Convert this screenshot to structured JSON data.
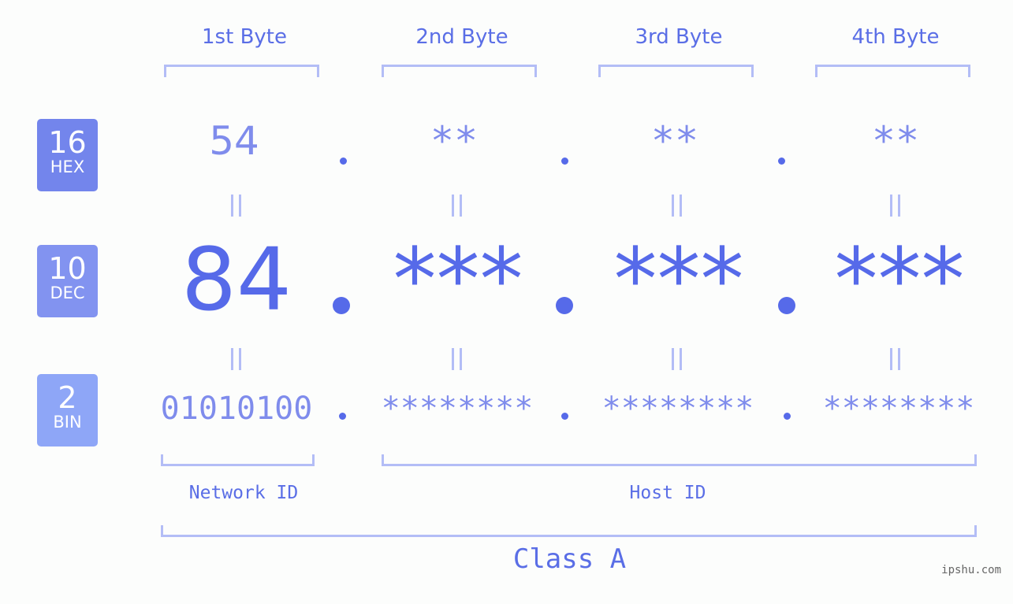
{
  "bytes": [
    {
      "label": "1st Byte",
      "hex": "54",
      "dec": "84",
      "bin": "01010100"
    },
    {
      "label": "2nd Byte",
      "hex": "**",
      "dec": "***",
      "bin": "********"
    },
    {
      "label": "3rd Byte",
      "hex": "**",
      "dec": "***",
      "bin": "********"
    },
    {
      "label": "4th Byte",
      "hex": "**",
      "dec": "***",
      "bin": "********"
    }
  ],
  "bases": [
    {
      "num": "16",
      "label": "HEX",
      "color": "#7385ec"
    },
    {
      "num": "10",
      "label": "DEC",
      "color": "#8293f0"
    },
    {
      "num": "2",
      "label": "BIN",
      "color": "#8ea6f7"
    }
  ],
  "network_id_label": "Network ID",
  "host_id_label": "Host ID",
  "class_label": "Class A",
  "watermark": "ipshu.com"
}
